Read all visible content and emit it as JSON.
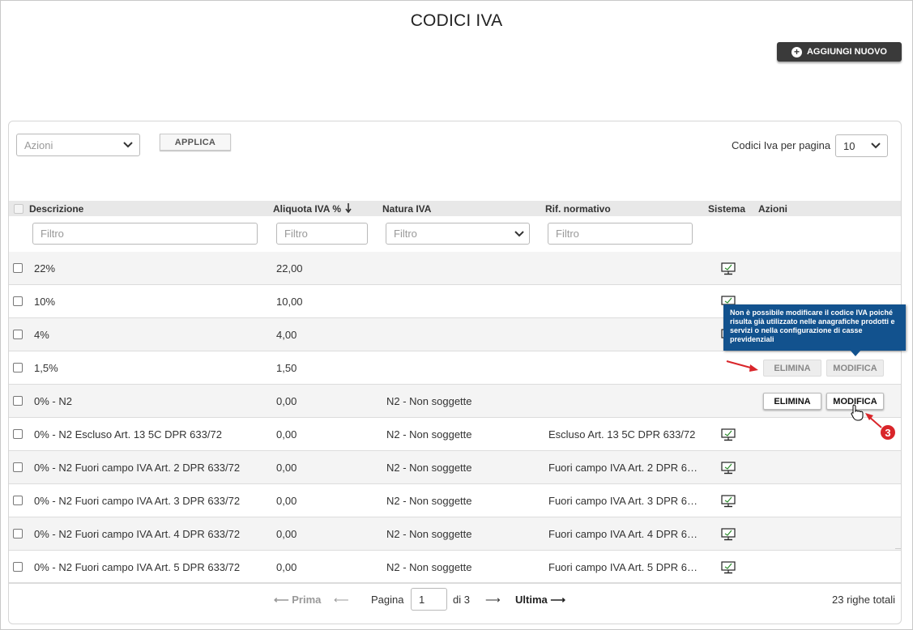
{
  "page": {
    "title": "CODICI IVA"
  },
  "toolbar": {
    "add_label": "AGGIUNGI NUOVO",
    "bulk_action_placeholder": "Azioni",
    "apply_label": "APPLICA",
    "per_page_label": "Codici Iva per pagina",
    "per_page_value": "10"
  },
  "table": {
    "columns": {
      "description": "Descrizione",
      "rate": "Aliquota IVA %",
      "nature": "Natura IVA",
      "reference": "Rif. normativo",
      "system": "Sistema",
      "actions": "Azioni"
    },
    "filter_placeholder": "Filtro",
    "rows": [
      {
        "description": "22%",
        "rate": "22,00",
        "nature": "",
        "reference": "",
        "system": true
      },
      {
        "description": "10%",
        "rate": "10,00",
        "nature": "",
        "reference": "",
        "system": true
      },
      {
        "description": "4%",
        "rate": "4,00",
        "nature": "",
        "reference": "",
        "system": true
      },
      {
        "description": "1,5%",
        "rate": "1,50",
        "nature": "",
        "reference": "",
        "system": false,
        "actions": [
          "ELIMINA",
          "MODIFICA"
        ],
        "actions_state": "disabled"
      },
      {
        "description": "0% - N2",
        "rate": "0,00",
        "nature": "N2 - Non soggette",
        "reference": "",
        "system": false,
        "actions": [
          "ELIMINA",
          "MODIFICA"
        ],
        "actions_state": "enabled"
      },
      {
        "description": "0% - N2 Escluso Art. 13 5C DPR 633/72",
        "rate": "0,00",
        "nature": "N2 - Non soggette",
        "reference": "Escluso Art. 13 5C DPR 633/72",
        "system": true
      },
      {
        "description": "0% - N2 Fuori campo IVA Art. 2 DPR 633/72",
        "rate": "0,00",
        "nature": "N2 - Non soggette",
        "reference": "Fuori campo IVA Art. 2 DPR 6…",
        "system": true
      },
      {
        "description": "0% - N2 Fuori campo IVA Art. 3 DPR 633/72",
        "rate": "0,00",
        "nature": "N2 - Non soggette",
        "reference": "Fuori campo IVA Art. 3 DPR 6…",
        "system": true
      },
      {
        "description": "0% - N2 Fuori campo IVA Art. 4 DPR 633/72",
        "rate": "0,00",
        "nature": "N2 - Non soggette",
        "reference": "Fuori campo IVA Art. 4 DPR 6…",
        "system": true
      },
      {
        "description": "0% - N2 Fuori campo IVA Art. 5 DPR 633/72",
        "rate": "0,00",
        "nature": "N2 - Non soggette",
        "reference": "Fuori campo IVA Art. 5 DPR 6…",
        "system": true
      }
    ]
  },
  "tooltip": {
    "text": "Non è possibile modificare il codice IVA poiché risulta già utilizzato nelle anagrafiche prodotti e servizi o nella configurazione di casse previdenziali"
  },
  "annotation": {
    "step_number": "3",
    "color": "#d9252a"
  },
  "pagination": {
    "first_label": "Prima",
    "page_label": "Pagina",
    "current_page": "1",
    "of_label": "di 3",
    "last_label": "Ultima",
    "total_label": "23 righe totali"
  },
  "icons": {
    "add": "plus-circle-icon",
    "dropdown": "chevron-down-icon",
    "sort": "arrow-down-icon",
    "system": "monitor-check-icon",
    "prev": "arrow-left-icon",
    "next": "arrow-right-icon",
    "cursor": "hand-pointer-icon"
  },
  "colors": {
    "tooltip_bg": "#12528e",
    "add_button_bg": "#3a3a3a",
    "header_bg": "#e8e8e8"
  }
}
